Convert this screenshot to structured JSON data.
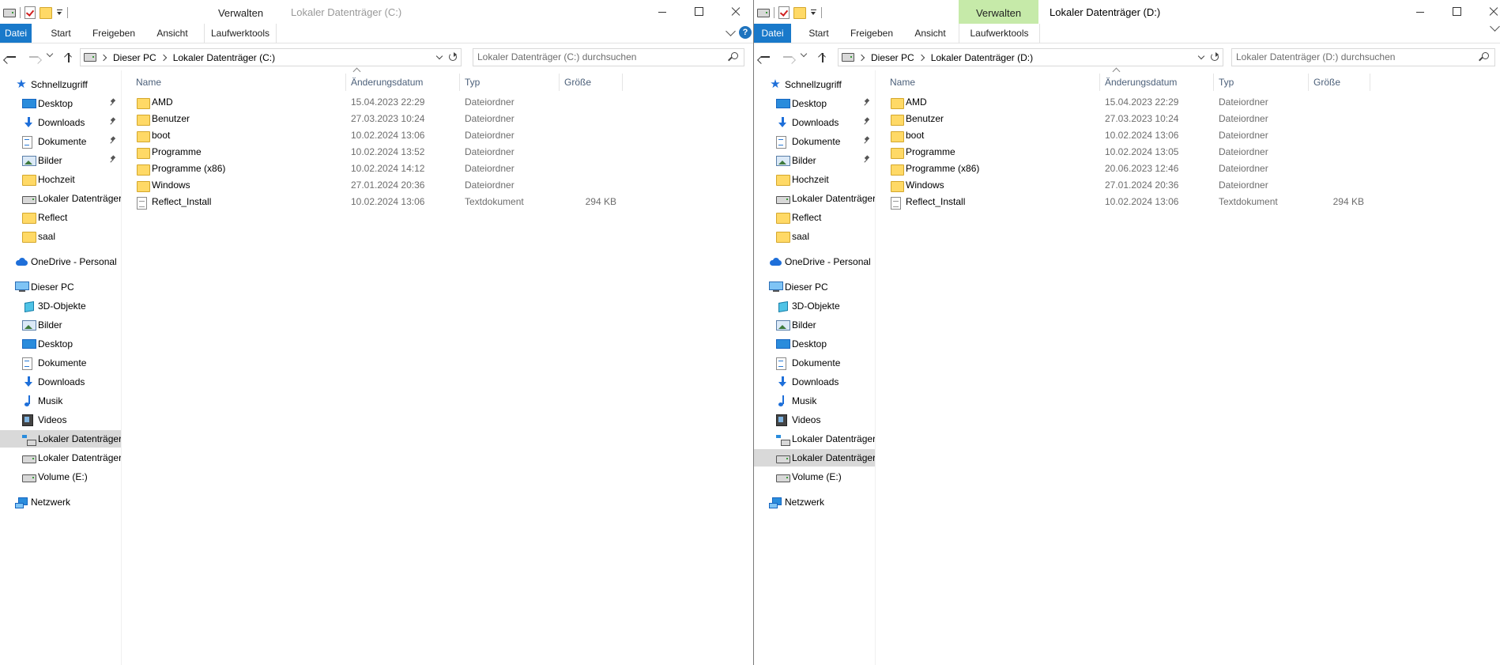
{
  "left": {
    "title": "Lokaler Datenträger (C:)",
    "verwalten": "Verwalten",
    "ribbon": {
      "file": "Datei",
      "tabs": [
        "Start",
        "Freigeben",
        "Ansicht",
        "Laufwerktools"
      ]
    },
    "path": [
      "Dieser PC",
      "Lokaler Datenträger (C:)"
    ],
    "search_placeholder": "Lokaler Datenträger (C:) durchsuchen",
    "columns": {
      "name": "Name",
      "date": "Änderungsdatum",
      "type": "Typ",
      "size": "Größe"
    },
    "files": [
      {
        "name": "AMD",
        "date": "15.04.2023 22:29",
        "type": "Dateiordner",
        "size": "",
        "icon": "folder-icon"
      },
      {
        "name": "Benutzer",
        "date": "27.03.2023 10:24",
        "type": "Dateiordner",
        "size": "",
        "icon": "folder-icon"
      },
      {
        "name": "boot",
        "date": "10.02.2024 13:06",
        "type": "Dateiordner",
        "size": "",
        "icon": "folder-icon"
      },
      {
        "name": "Programme",
        "date": "10.02.2024 13:52",
        "type": "Dateiordner",
        "size": "",
        "icon": "folder-icon"
      },
      {
        "name": "Programme (x86)",
        "date": "10.02.2024 14:12",
        "type": "Dateiordner",
        "size": "",
        "icon": "folder-icon"
      },
      {
        "name": "Windows",
        "date": "27.01.2024 20:36",
        "type": "Dateiordner",
        "size": "",
        "icon": "folder-icon"
      },
      {
        "name": "Reflect_Install",
        "date": "10.02.2024 13:06",
        "type": "Textdokument",
        "size": "294 KB",
        "icon": "text-file-icon"
      }
    ]
  },
  "right": {
    "title": "Lokaler Datenträger (D:)",
    "verwalten": "Verwalten",
    "ribbon": {
      "file": "Datei",
      "tabs": [
        "Start",
        "Freigeben",
        "Ansicht",
        "Laufwerktools"
      ]
    },
    "path": [
      "Dieser PC",
      "Lokaler Datenträger (D:)"
    ],
    "search_placeholder": "Lokaler Datenträger (D:) durchsuchen",
    "columns": {
      "name": "Name",
      "date": "Änderungsdatum",
      "type": "Typ",
      "size": "Größe"
    },
    "files": [
      {
        "name": "AMD",
        "date": "15.04.2023 22:29",
        "type": "Dateiordner",
        "size": "",
        "icon": "folder-icon"
      },
      {
        "name": "Benutzer",
        "date": "27.03.2023 10:24",
        "type": "Dateiordner",
        "size": "",
        "icon": "folder-icon"
      },
      {
        "name": "boot",
        "date": "10.02.2024 13:06",
        "type": "Dateiordner",
        "size": "",
        "icon": "folder-icon"
      },
      {
        "name": "Programme",
        "date": "10.02.2024 13:05",
        "type": "Dateiordner",
        "size": "",
        "icon": "folder-icon"
      },
      {
        "name": "Programme (x86)",
        "date": "20.06.2023 12:46",
        "type": "Dateiordner",
        "size": "",
        "icon": "folder-icon"
      },
      {
        "name": "Windows",
        "date": "27.01.2024 20:36",
        "type": "Dateiordner",
        "size": "",
        "icon": "folder-icon"
      },
      {
        "name": "Reflect_Install",
        "date": "10.02.2024 13:06",
        "type": "Textdokument",
        "size": "294 KB",
        "icon": "text-file-icon"
      }
    ]
  },
  "nav": {
    "schnellzugriff": "Schnellzugriff",
    "quick": [
      {
        "label": "Desktop",
        "icon": "desktop-icon",
        "pinned": true
      },
      {
        "label": "Downloads",
        "icon": "downloads-icon",
        "pinned": true
      },
      {
        "label": "Dokumente",
        "icon": "documents-icon",
        "pinned": true
      },
      {
        "label": "Bilder",
        "icon": "pictures-icon",
        "pinned": true
      },
      {
        "label": "Hochzeit",
        "icon": "folder-icon",
        "pinned": false
      },
      {
        "label": "Lokaler Datenträger",
        "icon": "drive-icon",
        "pinned": false
      },
      {
        "label": "Reflect",
        "icon": "folder-icon",
        "pinned": false
      },
      {
        "label": "saal",
        "icon": "folder-icon",
        "pinned": false
      }
    ],
    "onedrive": "OneDrive - Personal",
    "dieser_pc": "Dieser PC",
    "pc_items": [
      {
        "label": "3D-Objekte",
        "icon": "3d-objects-icon"
      },
      {
        "label": "Bilder",
        "icon": "pictures-icon"
      },
      {
        "label": "Desktop",
        "icon": "desktop-icon"
      },
      {
        "label": "Dokumente",
        "icon": "documents-icon"
      },
      {
        "label": "Downloads",
        "icon": "downloads-icon"
      },
      {
        "label": "Musik",
        "icon": "music-icon"
      },
      {
        "label": "Videos",
        "icon": "videos-icon"
      },
      {
        "label": "Lokaler Datenträger",
        "icon": "windows-drive-icon"
      },
      {
        "label": "Lokaler Datenträger",
        "icon": "drive-icon"
      },
      {
        "label": "Volume (E:)",
        "icon": "drive-icon"
      }
    ],
    "netzwerk": "Netzwerk"
  },
  "help_label": "?",
  "colors": {
    "accent": "#1979ca",
    "verwalten_bg": "#c6eaa9",
    "selection": "#d9d9d9"
  }
}
